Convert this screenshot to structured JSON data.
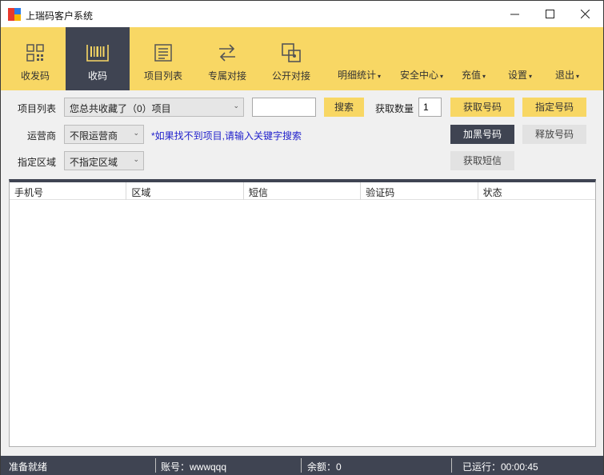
{
  "window": {
    "title": "上瑞码客户系统",
    "controls": {
      "minimize": "—",
      "maximize": "☐",
      "close": "✕"
    }
  },
  "toolbar": {
    "tools": [
      {
        "label": "收发码",
        "icon": "qr-icon"
      },
      {
        "label": "收码",
        "icon": "barcode-icon",
        "active": true
      },
      {
        "label": "项目列表",
        "icon": "list-icon"
      },
      {
        "label": "专属对接",
        "icon": "swap-arrows-icon"
      },
      {
        "label": "公开对接",
        "icon": "link-box-icon"
      }
    ],
    "menus": [
      {
        "label": "明细统计"
      },
      {
        "label": "安全中心"
      },
      {
        "label": "充值"
      },
      {
        "label": "设置"
      },
      {
        "label": "退出"
      }
    ],
    "caret": "▾"
  },
  "form": {
    "project_label": "项目列表",
    "project_select": "您总共收藏了（0）项目",
    "search_value": "",
    "search_button": "搜索",
    "fetch_count_label": "获取数量",
    "fetch_count_value": "1",
    "get_number_button": "获取号码",
    "specify_number_button": "指定号码",
    "carrier_label": "运营商",
    "carrier_select": "不限运营商",
    "hint": "*如果找不到项目,请输入关键字搜索",
    "blacklist_button": "加黑号码",
    "release_button": "释放号码",
    "region_label": "指定区域",
    "region_select": "不指定区域",
    "get_sms_button": "获取短信",
    "select_arrow": "⌄"
  },
  "table": {
    "columns": [
      "手机号",
      "区域",
      "短信",
      "验证码",
      "状态"
    ],
    "rows": []
  },
  "statusbar": {
    "status": "准备就绪",
    "account": "账号：wwwqqq",
    "balance": "余额：0",
    "runtime": "已运行：00:00:45"
  },
  "colors": {
    "accent_yellow": "#f8d764",
    "dark": "#3f4452",
    "hint_blue": "#2222cc"
  }
}
